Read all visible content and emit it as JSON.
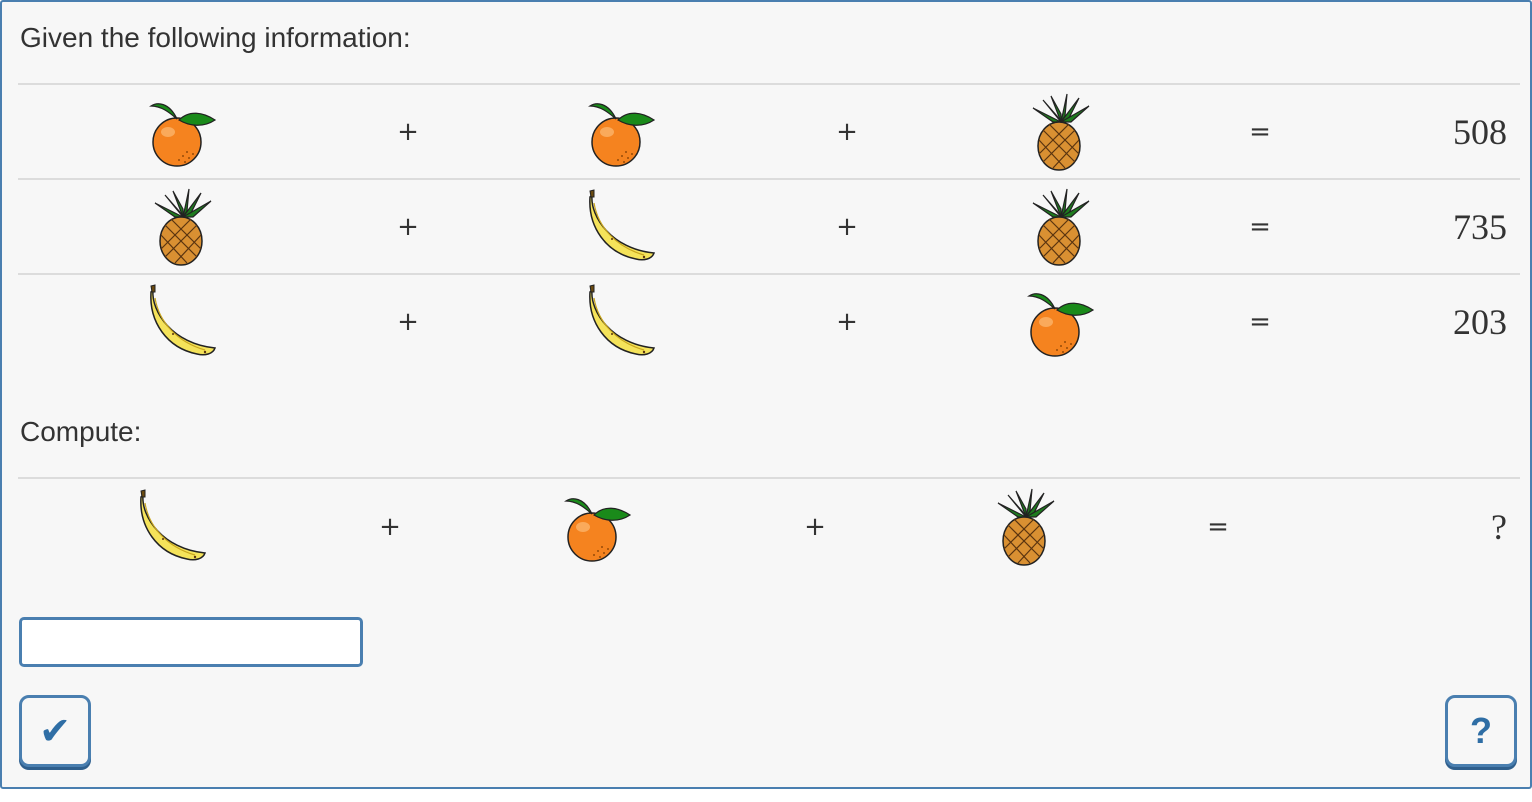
{
  "intro_label": "Given the following information:",
  "compute_label": "Compute:",
  "equations": [
    {
      "terms": [
        "orange",
        "orange",
        "pineapple"
      ],
      "op1": "+",
      "op2": "+",
      "eq": "=",
      "result": "508"
    },
    {
      "terms": [
        "pineapple",
        "banana",
        "pineapple"
      ],
      "op1": "+",
      "op2": "+",
      "eq": "=",
      "result": "735"
    },
    {
      "terms": [
        "banana",
        "banana",
        "orange"
      ],
      "op1": "+",
      "op2": "+",
      "eq": "=",
      "result": "203"
    }
  ],
  "question": {
    "terms": [
      "banana",
      "orange",
      "pineapple"
    ],
    "op1": "+",
    "op2": "+",
    "eq": "=",
    "result": "?"
  },
  "answer_input": {
    "value": "",
    "placeholder": ""
  },
  "buttons": {
    "check_label": "✔",
    "help_label": "?"
  },
  "icons": {
    "check": "checkmark-icon",
    "help": "question-icon"
  },
  "colors": {
    "accent": "#4a7fb0",
    "background": "#f7f7f7",
    "text": "#333333"
  }
}
